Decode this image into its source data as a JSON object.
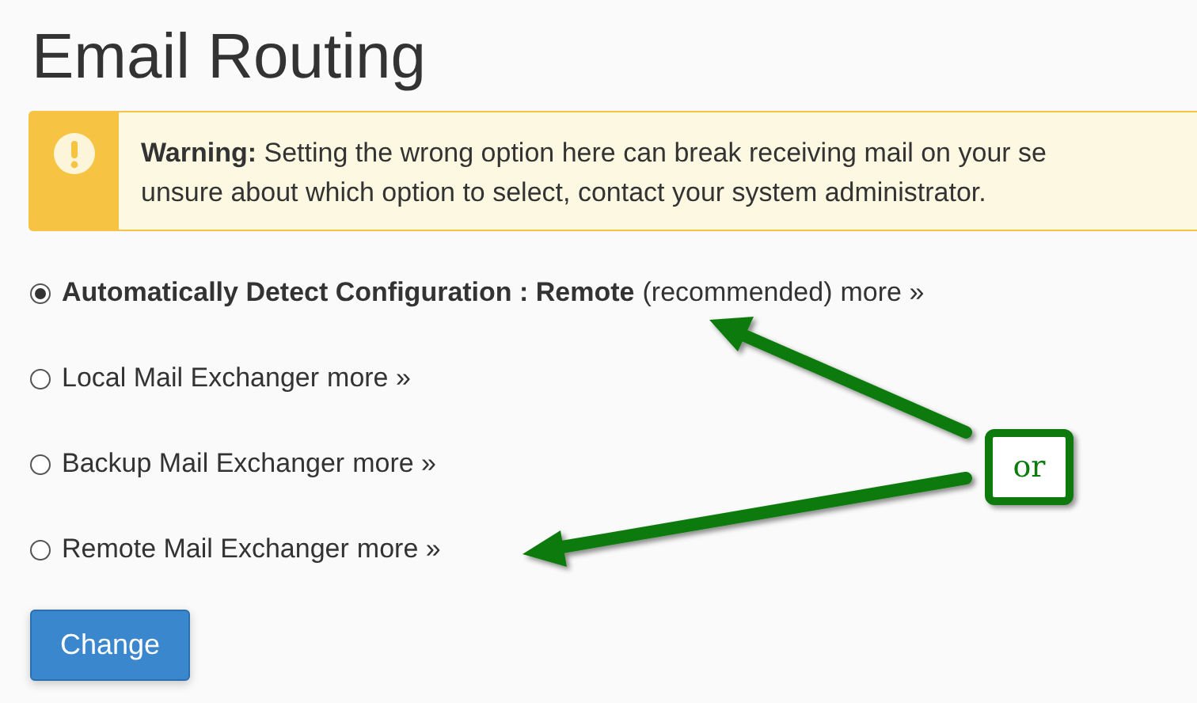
{
  "title": "Email Routing",
  "alert": {
    "lines": [
      "**Warning:** Setting the wrong option here can break receiving mail on your se",
      "unsure about which option to select, contact your system administrator."
    ]
  },
  "options": [
    {
      "label": "Automatically Detect Configuration : Remote",
      "note": "(recommended)",
      "link": "more »",
      "selected": true
    },
    {
      "label": "Local Mail Exchanger",
      "link": "more »",
      "selected": false
    },
    {
      "label": "Backup Mail Exchanger",
      "link": "more »",
      "selected": false
    },
    {
      "label": "Remote Mail Exchanger",
      "link": "more »",
      "selected": false
    }
  ],
  "button": "Change",
  "annotation": {
    "label": "or"
  }
}
